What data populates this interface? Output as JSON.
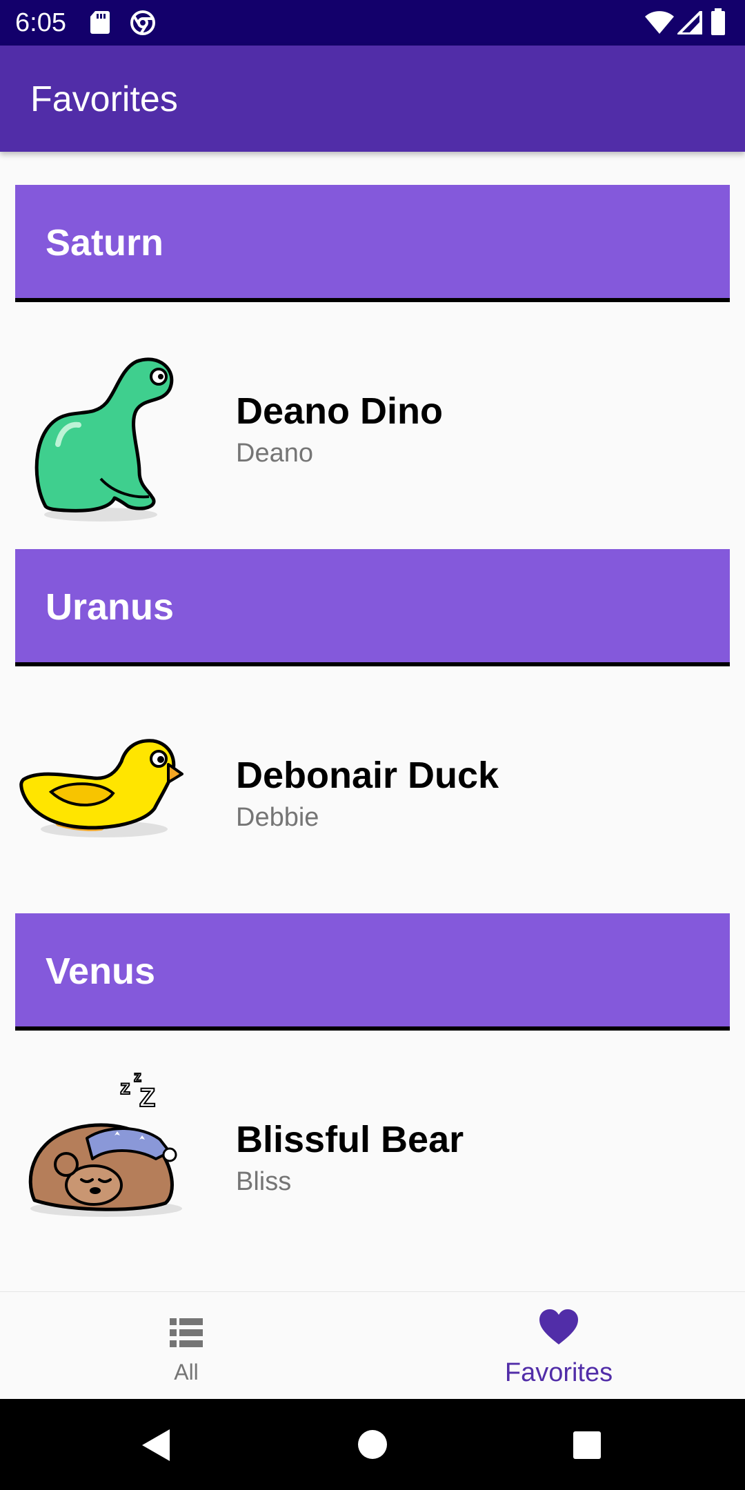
{
  "status_bar": {
    "time": "6:05",
    "icons": [
      "sd-card-icon",
      "chrome-icon",
      "wifi-icon",
      "signal-icon",
      "battery-icon"
    ]
  },
  "app_bar": {
    "title": "Favorites"
  },
  "sections": [
    {
      "planet": "Saturn",
      "sticker": {
        "name": "Deano Dino",
        "nickname": "Deano",
        "image": "dinosaur"
      }
    },
    {
      "planet": "Uranus",
      "sticker": {
        "name": "Debonair Duck",
        "nickname": "Debbie",
        "image": "duck"
      }
    },
    {
      "planet": "Venus",
      "sticker": {
        "name": "Blissful Bear",
        "nickname": "Bliss",
        "image": "sleeping-bear"
      }
    }
  ],
  "bottom_nav": {
    "items": [
      {
        "label": "All",
        "icon": "list-icon",
        "selected": false
      },
      {
        "label": "Favorites",
        "icon": "heart-icon",
        "selected": true
      }
    ]
  },
  "system_nav": {
    "buttons": [
      "back",
      "home",
      "recents"
    ]
  },
  "colors": {
    "status_bar": "#13006b",
    "app_bar": "#512da8",
    "section_header": "#8459db",
    "accent": "#512da8"
  }
}
